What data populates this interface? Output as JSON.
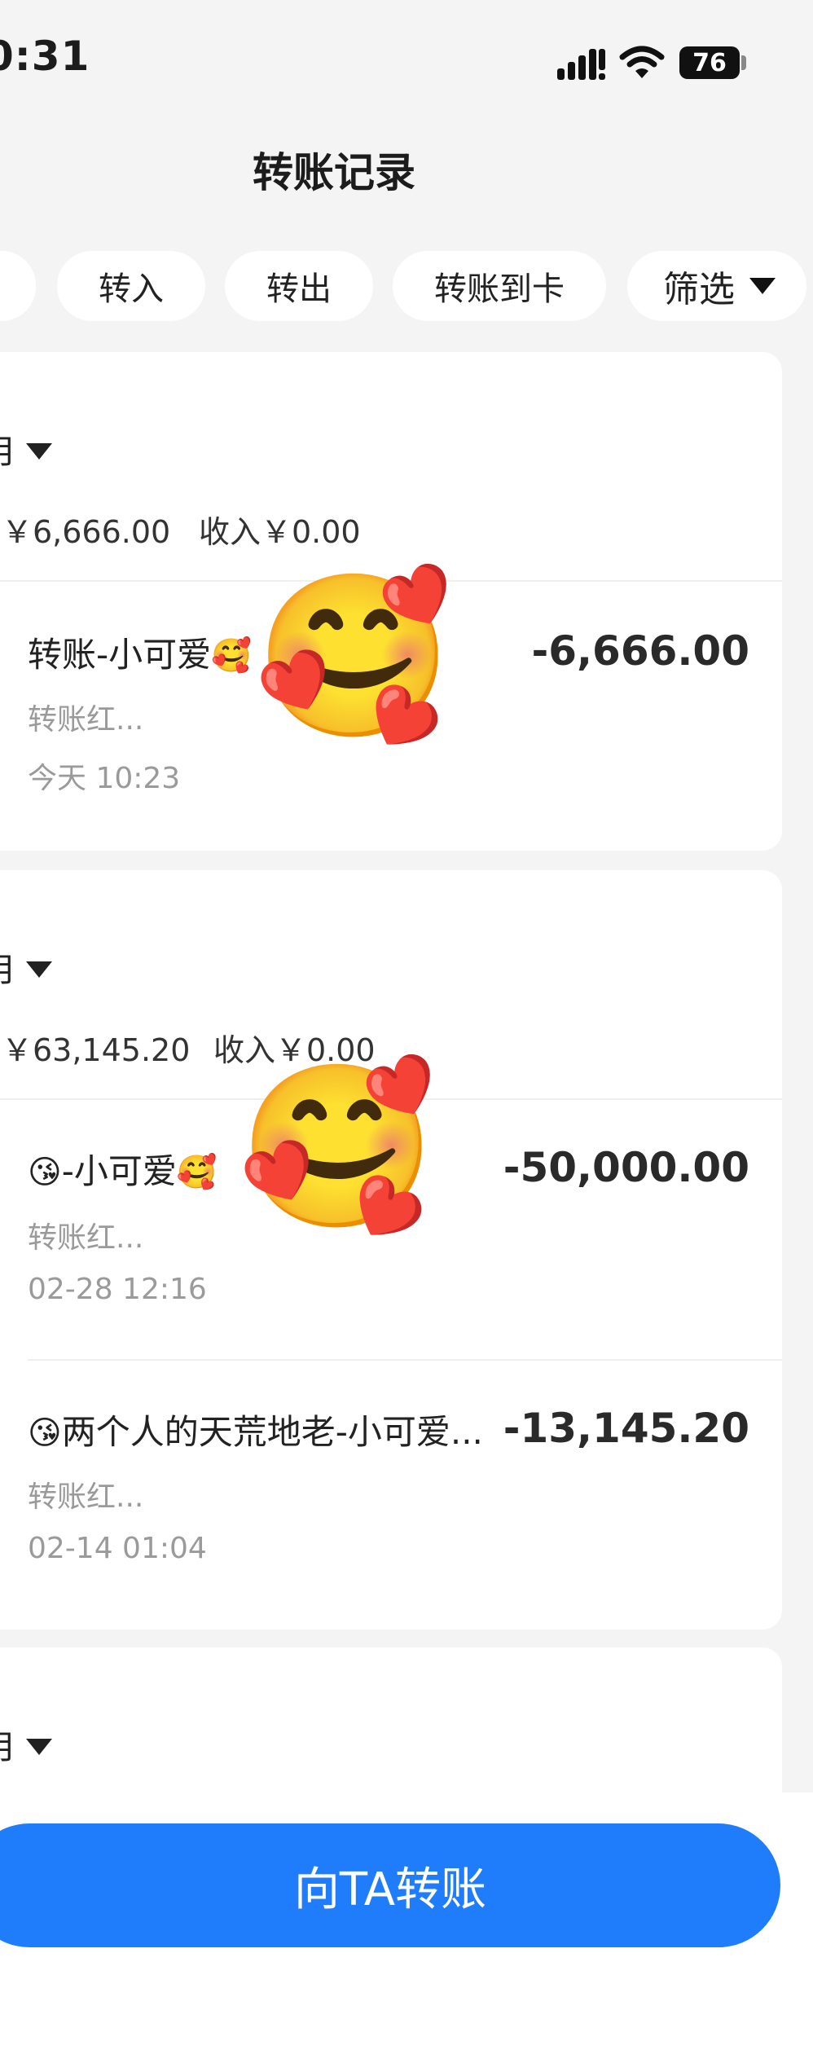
{
  "status_bar": {
    "time": "0:31",
    "battery": "76"
  },
  "header": {
    "title": "转账记录"
  },
  "filters": {
    "chips": [
      "转入",
      "转出",
      "转账到卡"
    ],
    "filter_label": "筛选"
  },
  "groups": [
    {
      "month_label": "月",
      "expense_summary": "￥6,666.00",
      "income_summary": "收入￥0.00",
      "transactions": [
        {
          "title": "转账-小可爱",
          "subtitle": "转账红...",
          "time": "今天 10:23",
          "amount": "-6,666.00"
        }
      ]
    },
    {
      "month_label": "月",
      "expense_summary": "￥63,145.20",
      "income_summary": "收入￥0.00",
      "transactions": [
        {
          "title": "-小可爱",
          "subtitle": "转账红...",
          "time": "02-28 12:16",
          "amount": "-50,000.00"
        },
        {
          "title": "两个人的天荒地老-小可爱...",
          "subtitle": "转账红...",
          "time": "02-14 01:04",
          "amount": "-13,145.20"
        }
      ]
    },
    {
      "month_label": "月"
    }
  ],
  "emoji": {
    "smiling_hearts": "🥰",
    "kiss": "😘"
  },
  "actions": {
    "send_button": "向TA转账"
  },
  "colors": {
    "primary": "#1f7cfb",
    "background": "#f4f4f4"
  }
}
